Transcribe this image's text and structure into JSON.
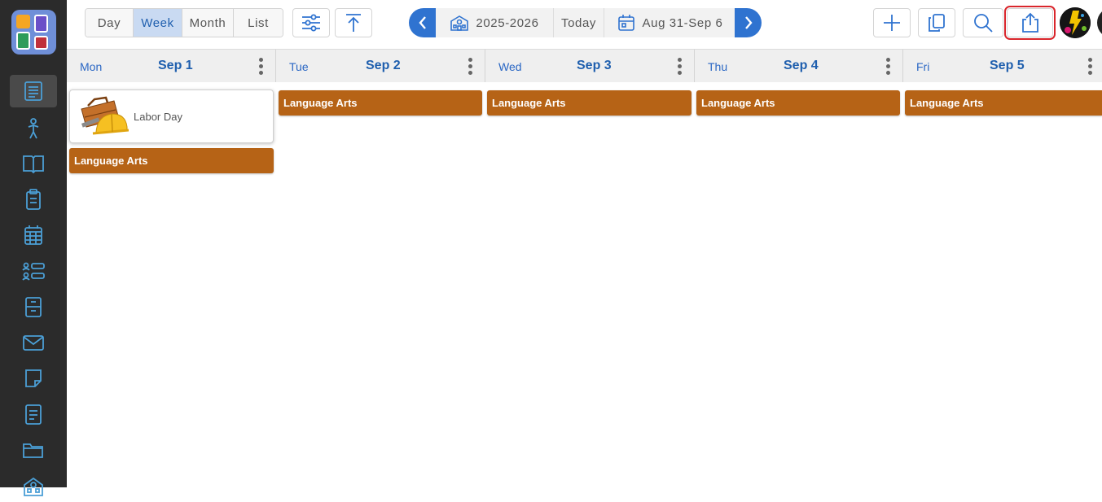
{
  "sidebar": {
    "items": [
      {
        "icon": "document-icon",
        "active": true
      },
      {
        "icon": "person-icon"
      },
      {
        "icon": "book-icon"
      },
      {
        "icon": "clipboard-icon"
      },
      {
        "icon": "calendar-grid-icon"
      },
      {
        "icon": "roster-icon"
      },
      {
        "icon": "cabinet-icon"
      },
      {
        "icon": "mail-icon"
      },
      {
        "icon": "sticky-note-icon"
      },
      {
        "icon": "text-file-icon"
      },
      {
        "icon": "folder-icon"
      },
      {
        "icon": "school-icon"
      }
    ]
  },
  "toolbar": {
    "views": [
      "Day",
      "Week",
      "Month",
      "List"
    ],
    "active_view": "Week",
    "school_year": "2025-2026",
    "today_label": "Today",
    "date_range": "Aug 31-Sep 6"
  },
  "days": [
    {
      "dow": "Mon",
      "date": "Sep 1"
    },
    {
      "dow": "Tue",
      "date": "Sep 2"
    },
    {
      "dow": "Wed",
      "date": "Sep 3"
    },
    {
      "dow": "Thu",
      "date": "Sep 4"
    },
    {
      "dow": "Fri",
      "date": "Sep 5"
    }
  ],
  "holiday": {
    "label": "Labor Day"
  },
  "events": {
    "mon": "Language Arts",
    "tue": "Language Arts",
    "wed": "Language Arts",
    "thu": "Language Arts",
    "fri": "Language Arts"
  },
  "colors": {
    "accent": "#2f73d0",
    "event": "#b66316",
    "export_highlight": "#d9262c"
  }
}
